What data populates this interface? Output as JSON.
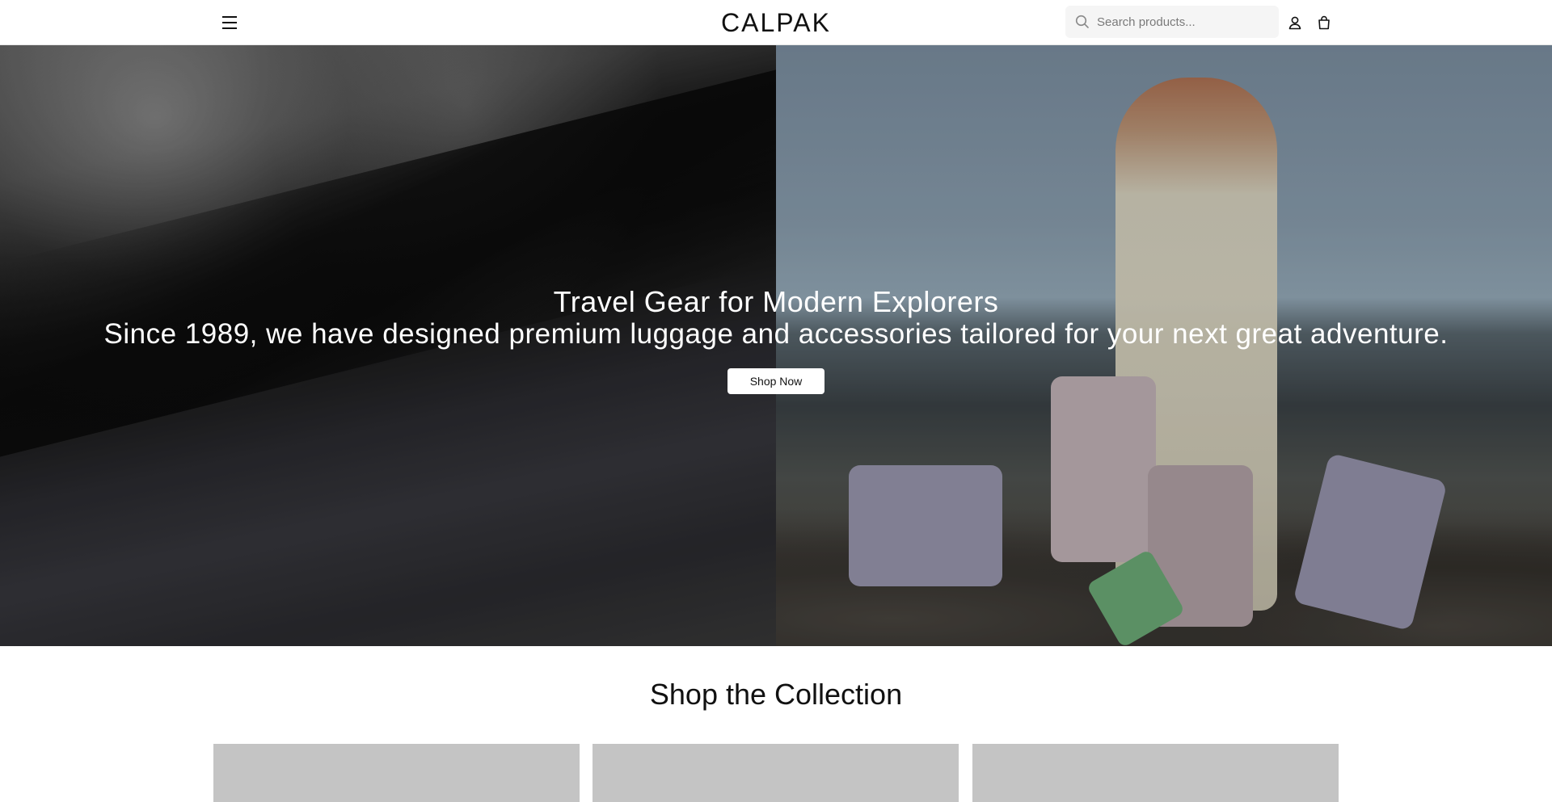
{
  "header": {
    "logo_text": "CALPAK",
    "menu_icon": "hamburger-menu-icon",
    "search": {
      "placeholder": "Search products...",
      "value": "",
      "icon": "search-icon"
    },
    "account_icon": "user-icon",
    "cart_icon": "shopping-bag-icon"
  },
  "hero": {
    "title": "Travel Gear for Modern Explorers",
    "subtitle": "Since 1989, we have designed premium luggage and accessories tailored for your next great adventure.",
    "cta_label": "Shop Now"
  },
  "collection": {
    "title": "Shop the Collection",
    "cards": [
      {
        "placeholder_color": "#c4c4c4"
      },
      {
        "placeholder_color": "#c4c4c4"
      },
      {
        "placeholder_color": "#c4c4c4"
      }
    ]
  },
  "colors": {
    "text": "#111111",
    "header_bg": "#ffffff",
    "search_bg": "#f5f5f5",
    "button_bg": "#ffffff"
  }
}
